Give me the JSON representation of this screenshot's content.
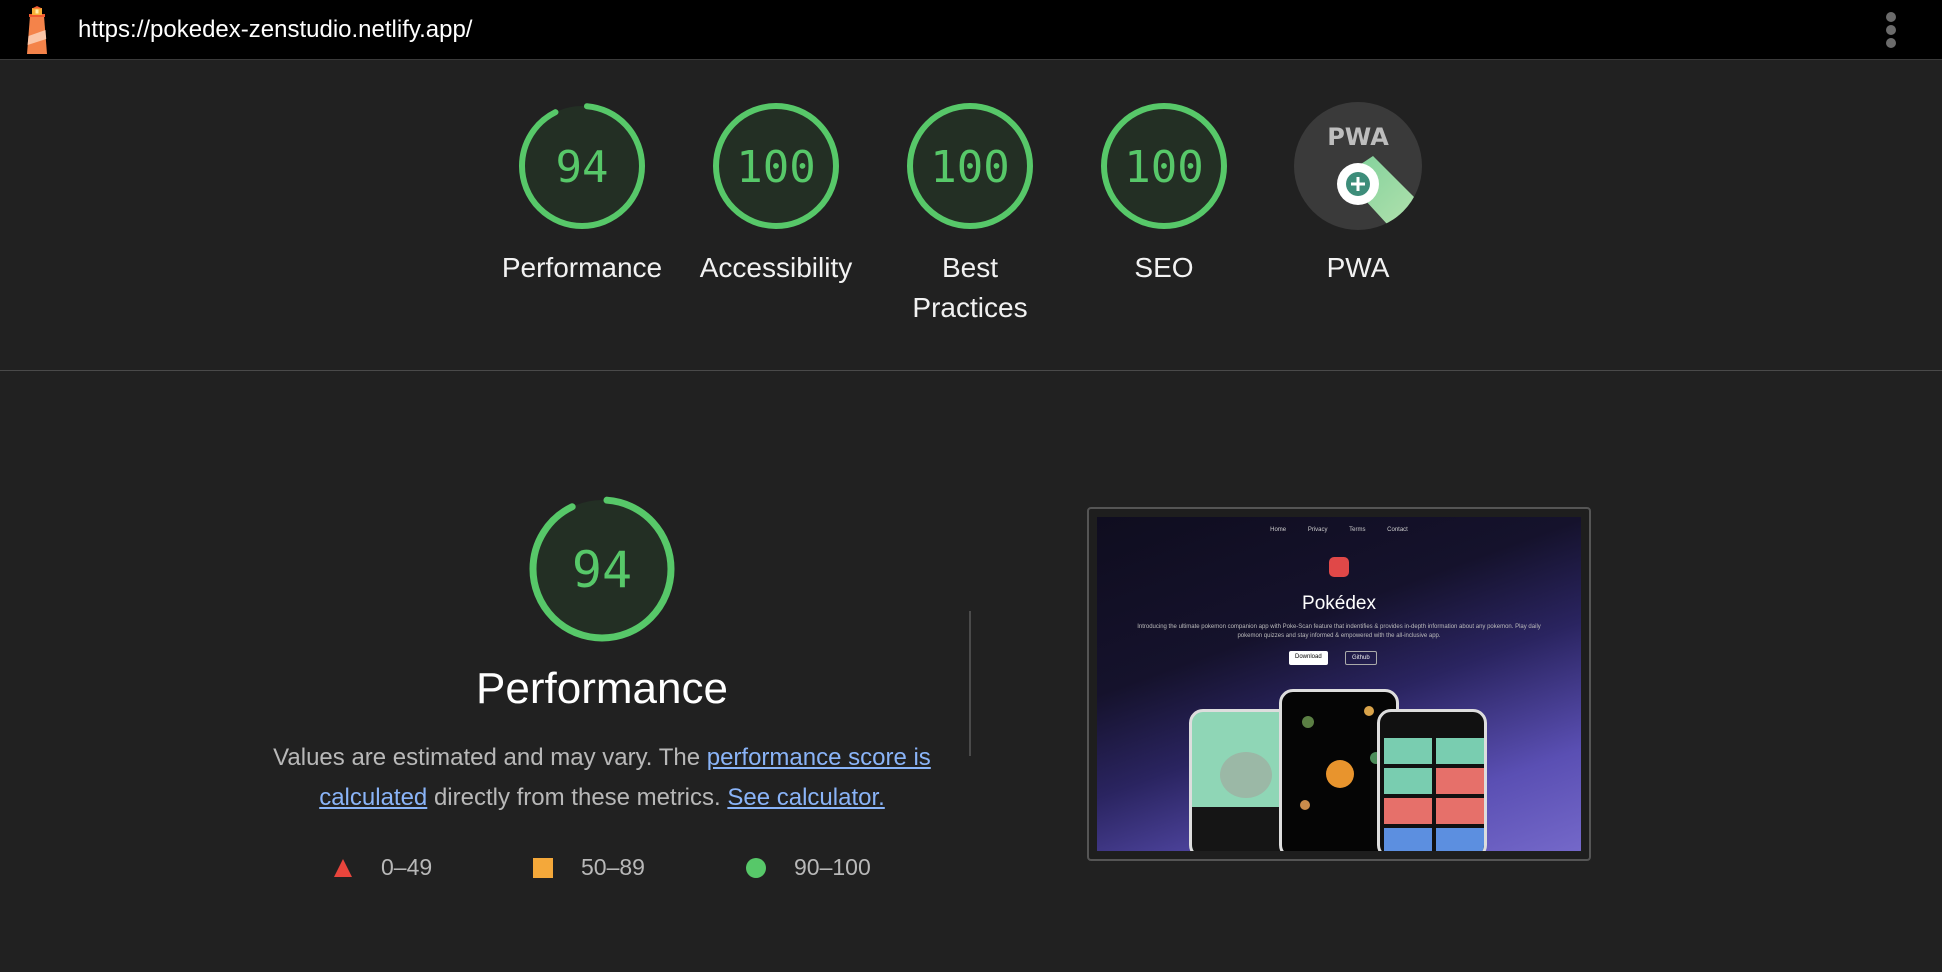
{
  "topbar": {
    "url": "https://pokedex-zenstudio.netlify.app/",
    "logo_icon": "lighthouse-icon",
    "menu_icon": "kebab-menu-icon"
  },
  "gauges": [
    {
      "label": "Performance",
      "score": "94",
      "value": 94
    },
    {
      "label": "Accessibility",
      "score": "100",
      "value": 100
    },
    {
      "label": "Best Practices",
      "score": "100",
      "value": 100
    },
    {
      "label": "SEO",
      "score": "100",
      "value": 100
    },
    {
      "label": "PWA",
      "badge": "PWA"
    }
  ],
  "performance": {
    "score": "94",
    "value": 94,
    "title": "Performance",
    "desc_prefix": "Values are estimated and may vary. The ",
    "link_score": "performance score is calculated",
    "desc_middle": " directly from these metrics. ",
    "link_calc": "See calculator."
  },
  "legend": [
    {
      "range": "0–49",
      "shape": "triangle",
      "color": "#e8453c"
    },
    {
      "range": "50–89",
      "shape": "square",
      "color": "#f4a83a"
    },
    {
      "range": "90–100",
      "shape": "circle",
      "color": "#57c869"
    }
  ],
  "preview": {
    "nav": [
      "Home",
      "Privacy",
      "Terms",
      "Contact"
    ],
    "title": "Pokédex",
    "subtitle": "Introducing the ultimate pokemon companion app with Poke-Scan feature that indentifies & provides in-depth information about any pokemon. Play daily pokemon quizzes and stay informed & empowered with the all-inclusive app.",
    "download_label": "Download",
    "github_label": "Github"
  },
  "colors": {
    "pass": "#57c869",
    "gauge_bg": "#232f24",
    "link": "#8ab4f8"
  }
}
